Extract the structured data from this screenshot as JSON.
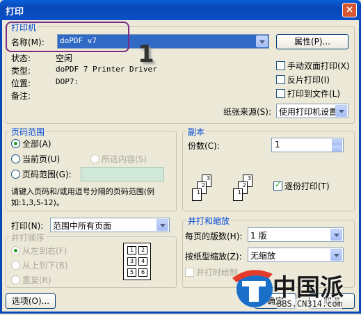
{
  "window": {
    "title": "打印",
    "close": "×"
  },
  "printer": {
    "legend": "打印机",
    "name_label": "名称(M):",
    "name_value": "doPDF v7",
    "properties_button": "属性(P)...",
    "status_label": "状态:",
    "status_value": "空闲",
    "type_label": "类型:",
    "type_value": "doPDF 7 Printer Driver",
    "location_label": "位置:",
    "location_value": "DOP7:",
    "comment_label": "备注:",
    "manual_duplex": "手动双面打印(X)",
    "reverse_print": "反片打印(I)",
    "print_to_file": "打印到文件(L)",
    "paper_source_label": "纸张来源(S):",
    "paper_source_value": "使用打印机设置",
    "annotation": "1"
  },
  "range": {
    "legend": "页码范围",
    "all": "全部(A)",
    "current": "当前页(U)",
    "selection": "所选内容(S)",
    "pages": "页码范围(G):",
    "hint": "请键入页码和/或用逗号分隔的页码范围(例如:1,3,5-12)。"
  },
  "copies": {
    "legend": "副本",
    "count_label": "份数(C):",
    "count_value": "1",
    "collate": "逐份打印(T)",
    "page_numbers": [
      "1",
      "2",
      "3"
    ]
  },
  "print_what": {
    "label": "打印(N):",
    "value": "范围中所有页面"
  },
  "order": {
    "legend": "并打顺序",
    "left_to_right": "从左到右(F)",
    "top_to_bottom": "从上到下(B)",
    "repeat": "重复(R)",
    "grid": [
      "1",
      "2",
      "3",
      "4",
      "5",
      "6"
    ]
  },
  "zoom": {
    "legend": "并打和缩放",
    "pages_per_sheet_label": "每页的版数(H):",
    "pages_per_sheet_value": "1 版",
    "scale_label": "按纸型缩放(Z):",
    "scale_value": "无缩放",
    "collate_draft": "并打时绘制..."
  },
  "buttons": {
    "options": "选项(O)...",
    "ok": "确定",
    "cancel": "取消"
  },
  "watermark": {
    "text": "中国派",
    "url": "BBS.CN314.com"
  },
  "colors": {
    "title_blue": "#0747b8",
    "legend_blue": "#0046d5",
    "highlight": "#7a2b84",
    "selection": "#316ac5"
  }
}
